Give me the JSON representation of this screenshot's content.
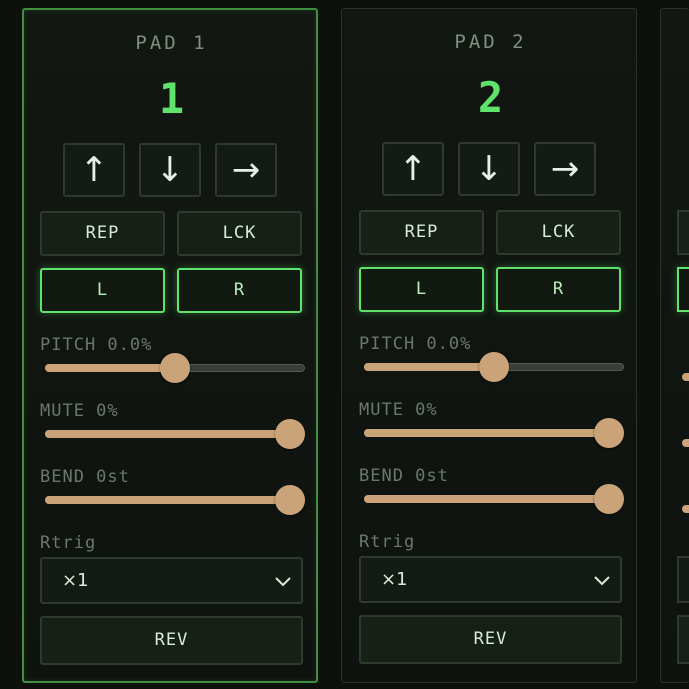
{
  "pads": [
    {
      "title": "PAD 1",
      "number": "1",
      "arrows": [
        "↑",
        "↓",
        "→"
      ],
      "rep_label": "REP",
      "lck_label": "LCK",
      "l_label": "L",
      "r_label": "R",
      "pitch_label": "PITCH 0.0%",
      "pitch_value": 0.5,
      "mute_label": "MUTE 0%",
      "mute_value": 1.0,
      "bend_label": "BEND 0st",
      "bend_value": 1.0,
      "rtrig_label": "Rtrig",
      "rtrig_selected": "×1",
      "rev_label": "REV",
      "active": true
    },
    {
      "title": "PAD 2",
      "number": "2",
      "arrows": [
        "↑",
        "↓",
        "→"
      ],
      "rep_label": "REP",
      "lck_label": "LCK",
      "l_label": "L",
      "r_label": "R",
      "pitch_label": "PITCH 0.0%",
      "pitch_value": 0.5,
      "mute_label": "MUTE 0%",
      "mute_value": 1.0,
      "bend_label": "BEND 0st",
      "bend_value": 1.0,
      "rtrig_label": "Rtrig",
      "rtrig_selected": "×1",
      "rev_label": "REV",
      "active": false
    }
  ],
  "colors": {
    "accent_green": "#5fe36a",
    "slider_tan": "#caa478",
    "background": "#0d100d"
  },
  "icons": {
    "select_caret": "chevron-down-icon"
  }
}
